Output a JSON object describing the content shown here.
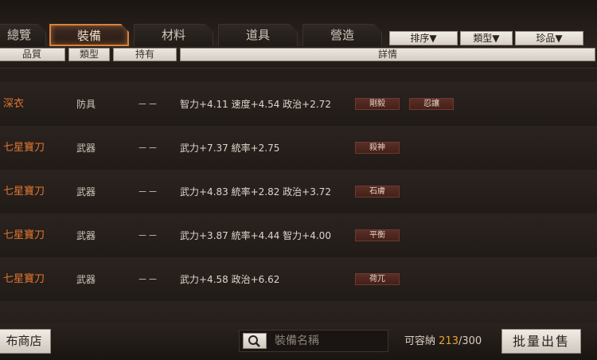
{
  "tabs": [
    {
      "label": "總覽"
    },
    {
      "label": "裝備",
      "active": true
    },
    {
      "label": "材料"
    },
    {
      "label": "道具"
    },
    {
      "label": "營造"
    }
  ],
  "sort_buttons": [
    "排序▼",
    "類型▼",
    "珍品▼"
  ],
  "columns": [
    "品質",
    "類型",
    "持有",
    "詳情"
  ],
  "rows": [
    {
      "name": "深衣",
      "type": "防具",
      "held": "－－",
      "stats": "智力+4.11  速度+4.54  政治+2.72",
      "tags": [
        "剛毅",
        "忍讓"
      ]
    },
    {
      "name": "七星寶刀",
      "type": "武器",
      "held": "－－",
      "stats": "武力+7.37  統率+2.75",
      "tags": [
        "殺神"
      ]
    },
    {
      "name": "七星寶刀",
      "type": "武器",
      "held": "－－",
      "stats": "武力+4.83  統率+2.82  政治+3.72",
      "tags": [
        "石膚"
      ]
    },
    {
      "name": "七星寶刀",
      "type": "武器",
      "held": "－－",
      "stats": "武力+3.87  統率+4.44  智力+4.00",
      "tags": [
        "平衡"
      ]
    },
    {
      "name": "七星寶刀",
      "type": "武器",
      "held": "－－",
      "stats": "武力+4.58  政治+6.62",
      "tags": [
        "荷兀"
      ]
    }
  ],
  "bottom": {
    "shop_label": "布商店",
    "search_placeholder": "裝備名稱",
    "capacity_label": "可容納",
    "capacity_current": "213",
    "capacity_max": "/300",
    "sell_label": "批量出售"
  },
  "colors": {
    "accent": "#d9823c",
    "item_name": "#e0762f",
    "capacity": "#e6a533"
  }
}
